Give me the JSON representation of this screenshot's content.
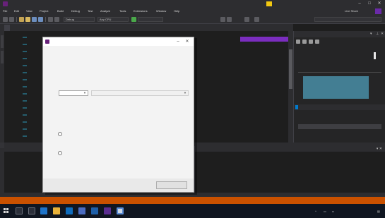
{
  "titlebar": {
    "title": "",
    "account_label": "",
    "minimize": "–",
    "maximize": "□",
    "close": "✕"
  },
  "menubar": {
    "items": [
      "File",
      "Edit",
      "View",
      "Project",
      "Build",
      "Debug",
      "Test",
      "Analyze",
      "Tools",
      "Extensions",
      "Window",
      "Help"
    ],
    "share_label": "Live Share"
  },
  "toolbar": {
    "configuration": "Debug",
    "platform": "Any CPU",
    "start_label": "",
    "search_placeholder": ""
  },
  "tabs": {
    "active_tab": ""
  },
  "editor": {
    "top_text": "",
    "live_badge": ""
  },
  "right_panel": {
    "title": "",
    "section1": "",
    "section1_value": "",
    "section2": "",
    "row_a": "",
    "row_b": "",
    "tabs": [
      "",
      "",
      ""
    ],
    "section3": "",
    "rows": [
      "",
      "",
      ""
    ]
  },
  "lower_panels": {
    "output_title": "",
    "output_body": "",
    "right_title": "",
    "right_body": ""
  },
  "bottom_tabs": {
    "items": [
      "",
      ""
    ],
    "faint_items": [
      "",
      "",
      "",
      ""
    ]
  },
  "status": {
    "left": "",
    "middle": "",
    "right": ""
  },
  "taskbar": {
    "time": "",
    "date": ""
  },
  "dialog": {
    "title": "",
    "heading1": "",
    "heading2": "",
    "field1_label": "",
    "field1_value": "",
    "field2_label": "",
    "field2_value": "",
    "section_heading": "",
    "option1": "",
    "option2_line1": "",
    "option2_line2": "",
    "primary_button": "",
    "minimize": "–",
    "close": "✕"
  },
  "colors": {
    "status_bar": "#ca5100",
    "accent_purple": "#7b2dbf",
    "notification": "#f2c811",
    "selection_blue": "#007acc",
    "graph": "#4d9cb8"
  }
}
